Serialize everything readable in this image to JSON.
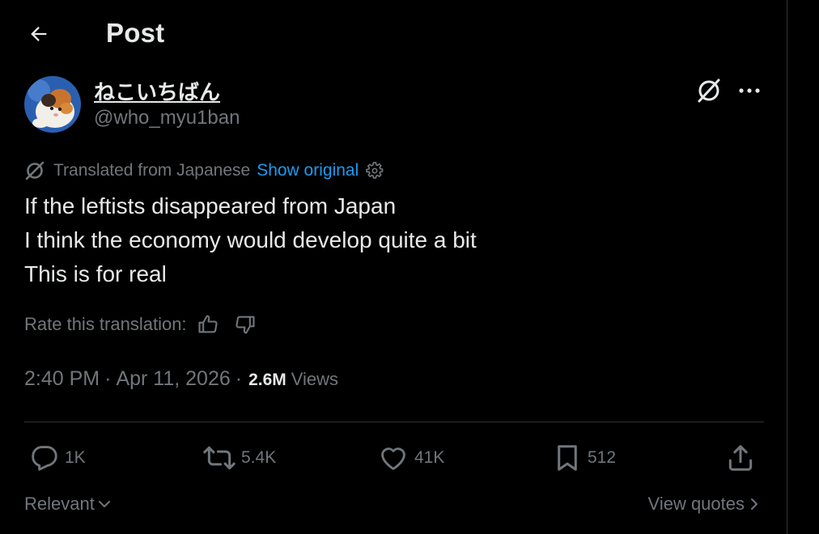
{
  "header": {
    "title": "Post"
  },
  "author": {
    "display_name": "ねこいちばん",
    "handle": "@who_myu1ban"
  },
  "translation": {
    "label": "Translated from Japanese",
    "show_original": "Show original"
  },
  "post": {
    "lines": [
      "If the leftists disappeared from Japan",
      "I think the economy would develop quite a bit",
      "This is for real"
    ]
  },
  "rate": {
    "label": "Rate this translation:"
  },
  "meta": {
    "time": "2:40 PM",
    "separator": "·",
    "date": "Apr 11, 2026",
    "views_count": "2.6M",
    "views_label": "Views"
  },
  "actions": {
    "replies": "1K",
    "reposts": "5.4K",
    "likes": "41K",
    "bookmarks": "512"
  },
  "footer": {
    "sort_label": "Relevant",
    "view_quotes": "View quotes"
  },
  "icons": {
    "back": "arrow-left-icon",
    "grok": "grok-icon",
    "more": "more-dots-icon",
    "translate": "translate-icon",
    "settings": "gear-icon",
    "thumbs_up": "thumbs-up-icon",
    "thumbs_down": "thumbs-down-icon",
    "reply": "reply-icon",
    "repost": "repost-icon",
    "like": "heart-icon",
    "bookmark": "bookmark-icon",
    "share": "share-icon",
    "chevron_down": "chevron-down-icon",
    "chevron_right": "chevron-right-icon"
  },
  "colors": {
    "background": "#000000",
    "text": "#e7e9ea",
    "muted": "#71767b",
    "link": "#1d9bf0",
    "border": "#2f3336"
  }
}
